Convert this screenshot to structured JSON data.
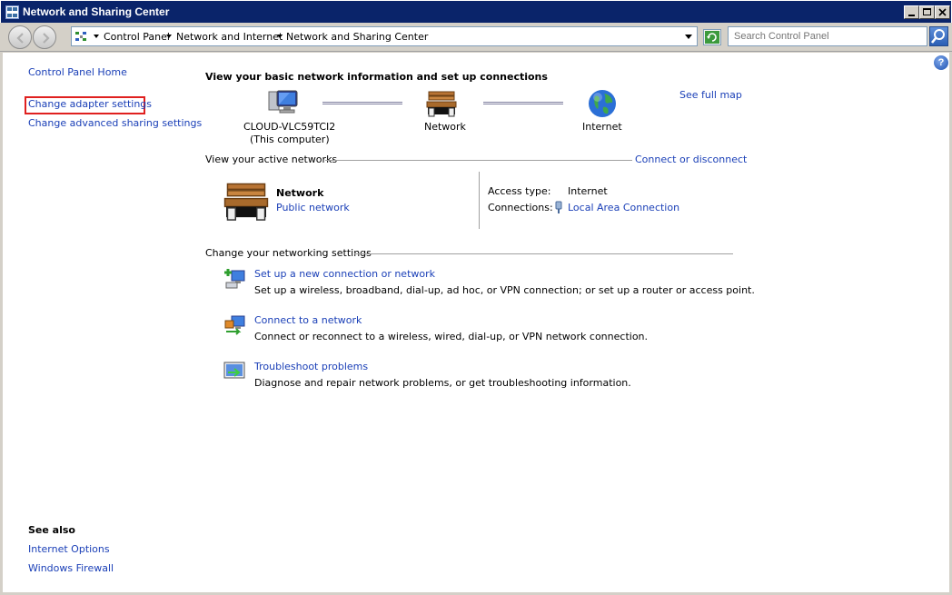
{
  "window": {
    "title": "Network and Sharing Center"
  },
  "address": {
    "crumbs": [
      "Control Panel",
      "Network and Internet",
      "Network and Sharing Center"
    ],
    "search_placeholder": "Search Control Panel"
  },
  "sidebar": {
    "home": "Control Panel Home",
    "change_adapter": "Change adapter settings",
    "change_sharing": "Change advanced sharing settings",
    "see_also_title": "See also",
    "internet_options": "Internet Options",
    "windows_firewall": "Windows Firewall"
  },
  "main": {
    "heading": "View your basic network information and set up connections",
    "see_full_map": "See full map",
    "map": {
      "computer_name": "CLOUD-VLC59TCI2",
      "computer_sub": "(This computer)",
      "network": "Network",
      "internet": "Internet"
    },
    "active_networks_label": "View your active networks",
    "connect_disconnect": "Connect or disconnect",
    "active": {
      "name": "Network",
      "type": "Public network",
      "access_type_label": "Access type:",
      "access_type_value": "Internet",
      "connections_label": "Connections:",
      "connections_value": "Local Area Connection"
    },
    "change_settings_label": "Change your networking settings",
    "tasks": [
      {
        "title": "Set up a new connection or network",
        "desc": "Set up a wireless, broadband, dial-up, ad hoc, or VPN connection; or set up a router or access point."
      },
      {
        "title": "Connect to a network",
        "desc": "Connect or reconnect to a wireless, wired, dial-up, or VPN network connection."
      },
      {
        "title": "Troubleshoot problems",
        "desc": "Diagnose and repair network problems, or get troubleshooting information."
      }
    ]
  },
  "icons": {
    "computer": "computer-icon",
    "network": "bench-network-icon",
    "internet": "globe-icon",
    "new_connection": "new-connection-icon",
    "connect": "connect-network-icon",
    "troubleshoot": "troubleshoot-icon"
  },
  "colors": {
    "link": "#1a3fb7",
    "titlebar": "#0a246a",
    "highlight_box": "#e0201f"
  }
}
